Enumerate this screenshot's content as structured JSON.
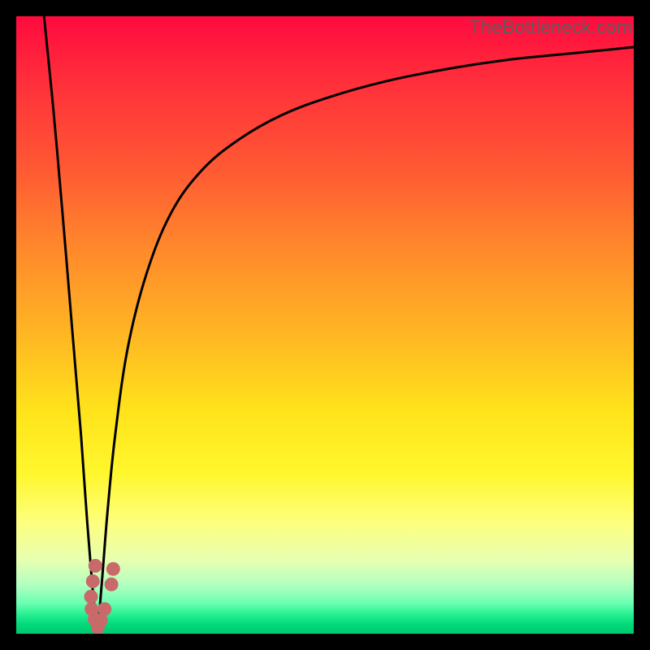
{
  "watermark": "TheBottleneck.com",
  "colors": {
    "curve": "#000000",
    "marker_fill": "#c86a6a",
    "marker_stroke": "#ffffff"
  },
  "chart_data": {
    "type": "line",
    "title": "",
    "xlabel": "",
    "ylabel": "",
    "xlim": [
      0,
      100
    ],
    "ylim": [
      0,
      100
    ],
    "grid": false,
    "legend": false,
    "series": [
      {
        "name": "left-branch",
        "x": [
          4.5,
          6.0,
          7.5,
          9.0,
          10.5,
          11.5,
          12.3,
          12.8,
          13.1
        ],
        "y": [
          100,
          85,
          68,
          50,
          32,
          18,
          8,
          3,
          0
        ]
      },
      {
        "name": "right-branch",
        "x": [
          13.1,
          13.5,
          14.0,
          14.8,
          16.0,
          18.0,
          21.0,
          25.0,
          30.0,
          36.0,
          43.0,
          51.0,
          60.0,
          70.0,
          80.0,
          90.0,
          100.0
        ],
        "y": [
          0,
          4,
          10,
          20,
          32,
          46,
          58,
          68,
          75,
          80,
          84,
          87,
          89.5,
          91.5,
          93,
          94,
          95
        ]
      }
    ],
    "markers": {
      "name": "dots",
      "points": [
        {
          "x": 12.8,
          "y": 11.0
        },
        {
          "x": 12.4,
          "y": 8.5
        },
        {
          "x": 12.1,
          "y": 6.0
        },
        {
          "x": 12.2,
          "y": 4.0
        },
        {
          "x": 12.7,
          "y": 2.3
        },
        {
          "x": 13.2,
          "y": 1.0
        },
        {
          "x": 13.7,
          "y": 2.2
        },
        {
          "x": 14.3,
          "y": 4.0
        },
        {
          "x": 15.4,
          "y": 8.0
        },
        {
          "x": 15.7,
          "y": 10.5
        }
      ]
    }
  }
}
